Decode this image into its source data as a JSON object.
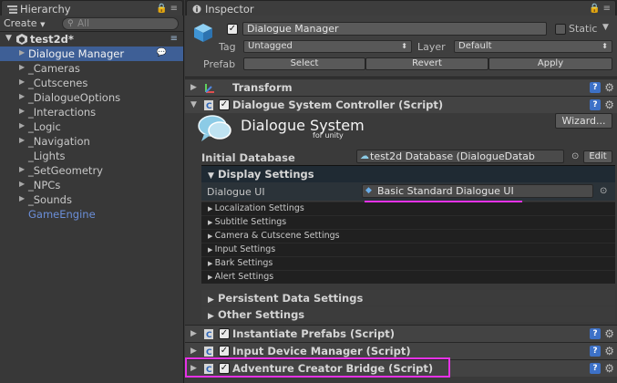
{
  "hierarchy": {
    "tab_label": "Hierarchy",
    "create_label": "Create",
    "search_placeholder": "All",
    "scene_name": "test2d*",
    "items": [
      {
        "label": "Dialogue Manager",
        "selected": true,
        "expandable": true
      },
      {
        "label": "_Cameras",
        "expandable": true
      },
      {
        "label": "_Cutscenes",
        "expandable": true
      },
      {
        "label": "_DialogueOptions",
        "expandable": true
      },
      {
        "label": "_Interactions",
        "expandable": true
      },
      {
        "label": "_Logic",
        "expandable": true
      },
      {
        "label": "_Navigation",
        "expandable": true
      },
      {
        "label": "_Lights",
        "expandable": false
      },
      {
        "label": "_SetGeometry",
        "expandable": true
      },
      {
        "label": "_NPCs",
        "expandable": true
      },
      {
        "label": "_Sounds",
        "expandable": true
      },
      {
        "label": "GameEngine",
        "expandable": false,
        "prefab": true
      }
    ]
  },
  "inspector": {
    "tab_label": "Inspector",
    "object_name": "Dialogue Manager",
    "static_label": "Static",
    "tag_label": "Tag",
    "tag_value": "Untagged",
    "layer_label": "Layer",
    "layer_value": "Default",
    "prefab_label": "Prefab",
    "select_label": "Select",
    "revert_label": "Revert",
    "apply_label": "Apply",
    "components": {
      "transform": "Transform",
      "controller": "Dialogue System Controller (Script)",
      "instantiate": "Instantiate Prefabs (Script)",
      "input_device": "Input Device Manager (Script)",
      "ac_bridge": "Adventure Creator Bridge (Script)"
    },
    "logo_text": "Dialogue System",
    "logo_sub": "for unity",
    "wizard_label": "Wizard...",
    "initial_db_label": "Initial Database",
    "initial_db_value": "test2d Database (DialogueDatab",
    "edit_label": "Edit",
    "display_settings": "Display Settings",
    "dialogue_ui_label": "Dialogue UI",
    "dialogue_ui_value": "Basic Standard Dialogue UI",
    "sub_settings": [
      "Localization Settings",
      "Subtitle Settings",
      "Camera & Cutscene Settings",
      "Input Settings",
      "Bark Settings",
      "Alert Settings"
    ],
    "persistent_data": "Persistent Data Settings",
    "other_settings": "Other Settings"
  },
  "colors": {
    "selection": "#3e5f96",
    "highlight": "#e632e6",
    "prefab_text": "#6b8fd9"
  }
}
